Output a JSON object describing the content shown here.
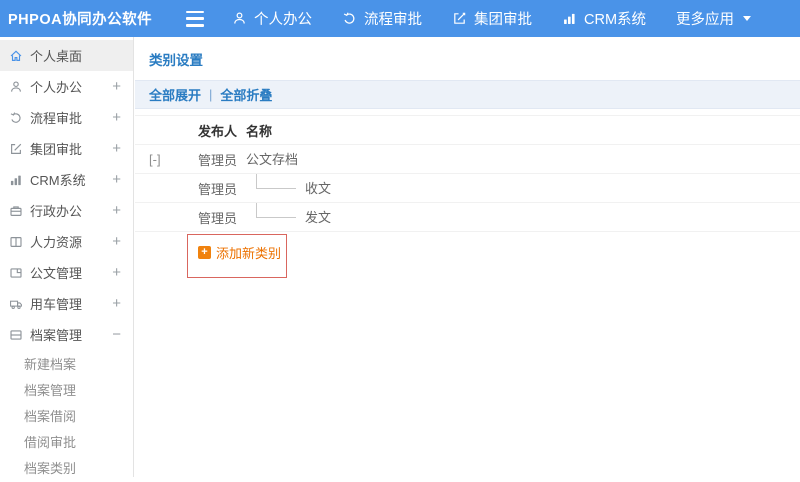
{
  "colors": {
    "topbar_blue": "#4a93e8",
    "link_blue": "#2a7cc2",
    "orange": "#ec7100",
    "highlight_red": "#d9665e"
  },
  "topbar": {
    "logo": "PHPOA协同办公软件",
    "menu_icon": "hamburger-icon",
    "nav": [
      {
        "label": "个人办公",
        "icon": "person-icon"
      },
      {
        "label": "流程审批",
        "icon": "flow-icon"
      },
      {
        "label": "集团审批",
        "icon": "edit-icon"
      },
      {
        "label": "CRM系统",
        "icon": "bar-chart-icon"
      },
      {
        "label": "更多应用",
        "icon": "caret-down-icon"
      }
    ]
  },
  "sidebar": {
    "items": [
      {
        "label": "个人桌面",
        "icon": "home-icon",
        "expander": ""
      },
      {
        "label": "个人办公",
        "icon": "person-icon",
        "expander": "+"
      },
      {
        "label": "流程审批",
        "icon": "flow-icon",
        "expander": "+"
      },
      {
        "label": "集团审批",
        "icon": "edit-icon",
        "expander": "+"
      },
      {
        "label": "CRM系统",
        "icon": "bar-chart-icon",
        "expander": "+"
      },
      {
        "label": "行政办公",
        "icon": "briefcase-icon",
        "expander": "+"
      },
      {
        "label": "人力资源",
        "icon": "book-icon",
        "expander": "+"
      },
      {
        "label": "公文管理",
        "icon": "document-icon",
        "expander": "+"
      },
      {
        "label": "用车管理",
        "icon": "truck-icon",
        "expander": "+"
      },
      {
        "label": "档案管理",
        "icon": "archive-icon",
        "expander": "−"
      }
    ],
    "subitems": [
      {
        "label": "新建档案"
      },
      {
        "label": "档案管理"
      },
      {
        "label": "档案借阅"
      },
      {
        "label": "借阅审批"
      },
      {
        "label": "档案类别"
      }
    ]
  },
  "main": {
    "title": "类别设置",
    "toolbar": {
      "expand_all": "全部展开",
      "separator": "|",
      "collapse_all": "全部折叠"
    },
    "table": {
      "columns": [
        "发布人",
        "名称"
      ],
      "rows": [
        {
          "toggle": "[-]",
          "publisher": "管理员",
          "name": "公文存档"
        },
        {
          "toggle": "",
          "publisher": "管理员",
          "name": "收文"
        },
        {
          "toggle": "",
          "publisher": "管理员",
          "name": "发文"
        }
      ]
    },
    "add_button": {
      "label": "添加新类别",
      "icon": "plus-icon",
      "plus_glyph": "+"
    }
  }
}
